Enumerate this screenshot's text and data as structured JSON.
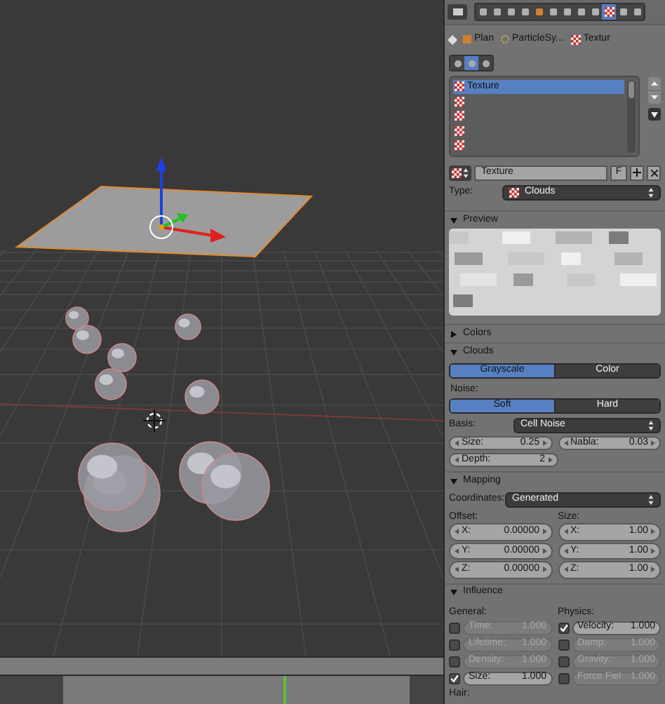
{
  "properties_header": {
    "context_tabs": [
      {
        "selected": false
      },
      {
        "selected": false
      },
      {
        "selected": false
      },
      {
        "selected": false
      },
      {
        "selected": false
      },
      {
        "selected": false
      },
      {
        "selected": false
      },
      {
        "selected": false
      },
      {
        "selected": false
      },
      {
        "selected": true
      },
      {
        "selected": false
      },
      {
        "selected": false
      }
    ]
  },
  "breadcrumb": [
    {
      "label": "Plan",
      "kind": "object"
    },
    {
      "label": "ParticleSy...",
      "kind": "particles"
    },
    {
      "label": "Textur",
      "kind": "texture"
    }
  ],
  "texture_context_tabs": [
    {
      "selected": false
    },
    {
      "selected": true
    },
    {
      "selected": false
    }
  ],
  "texture_slots": [
    {
      "name": "Texture",
      "selected": true
    },
    {
      "selected": false
    },
    {
      "selected": false
    },
    {
      "selected": false
    },
    {
      "selected": false
    }
  ],
  "texture_datablock": {
    "name": "Texture",
    "fake_user_button": "F"
  },
  "type": {
    "label": "Type:",
    "value": "Clouds"
  },
  "panels": [
    {
      "kind": "preview",
      "title": "Preview",
      "expanded": true
    },
    {
      "kind": "colors",
      "title": "Colors",
      "expanded": false
    },
    {
      "kind": "clouds",
      "title": "Clouds",
      "expanded": true,
      "color_mode": [
        {
          "label": "Grayscale",
          "selected": true
        },
        {
          "label": "Color",
          "selected": false
        }
      ],
      "noise_label": "Noise:",
      "noise_type": [
        {
          "label": "Soft",
          "selected": true
        },
        {
          "label": "Hard",
          "selected": false
        }
      ],
      "basis": {
        "label": "Basis:",
        "value": "Cell Noise"
      },
      "fields": [
        {
          "label": "Size:",
          "value": "0.25"
        },
        {
          "label": "Nabla:",
          "value": "0.03"
        },
        {
          "label": "Depth:",
          "value": "2"
        }
      ]
    },
    {
      "kind": "mapping",
      "title": "Mapping",
      "expanded": true,
      "coordinates": {
        "label": "Coordinates:",
        "value": "Generated"
      },
      "vectors": [
        {
          "label": "Offset:",
          "fields": [
            {
              "label": "X:",
              "value": "0.00000"
            },
            {
              "label": "Y:",
              "value": "0.00000"
            },
            {
              "label": "Z:",
              "value": "0.00000"
            }
          ]
        },
        {
          "label": "Size:",
          "fields": [
            {
              "label": "X:",
              "value": "1.00"
            },
            {
              "label": "Y:",
              "value": "1.00"
            },
            {
              "label": "Z:",
              "value": "1.00"
            }
          ]
        }
      ]
    },
    {
      "kind": "influence",
      "title": "Influence",
      "expanded": true,
      "groups": [
        {
          "label": "General:",
          "items": [
            {
              "label": "Time:",
              "value": "1.000",
              "checked": false,
              "disabled": true
            },
            {
              "label": "Lifetime:",
              "value": "1.000",
              "checked": false,
              "disabled": true
            },
            {
              "label": "Density:",
              "value": "1.000",
              "checked": false,
              "disabled": true
            },
            {
              "label": "Size:",
              "value": "1.000",
              "checked": true,
              "disabled": false
            }
          ]
        },
        {
          "label": "Physics:",
          "items": [
            {
              "label": "Velocity:",
              "value": "1.000",
              "checked": true,
              "disabled": false
            },
            {
              "label": "Damp:",
              "value": "1.000",
              "checked": false,
              "disabled": true
            },
            {
              "label": "Gravity:",
              "value": "1.000",
              "checked": false,
              "disabled": true
            },
            {
              "label": "Force Fiel",
              "value": "1.000",
              "checked": false,
              "disabled": true
            }
          ]
        }
      ],
      "hair_label": "Hair:"
    }
  ]
}
